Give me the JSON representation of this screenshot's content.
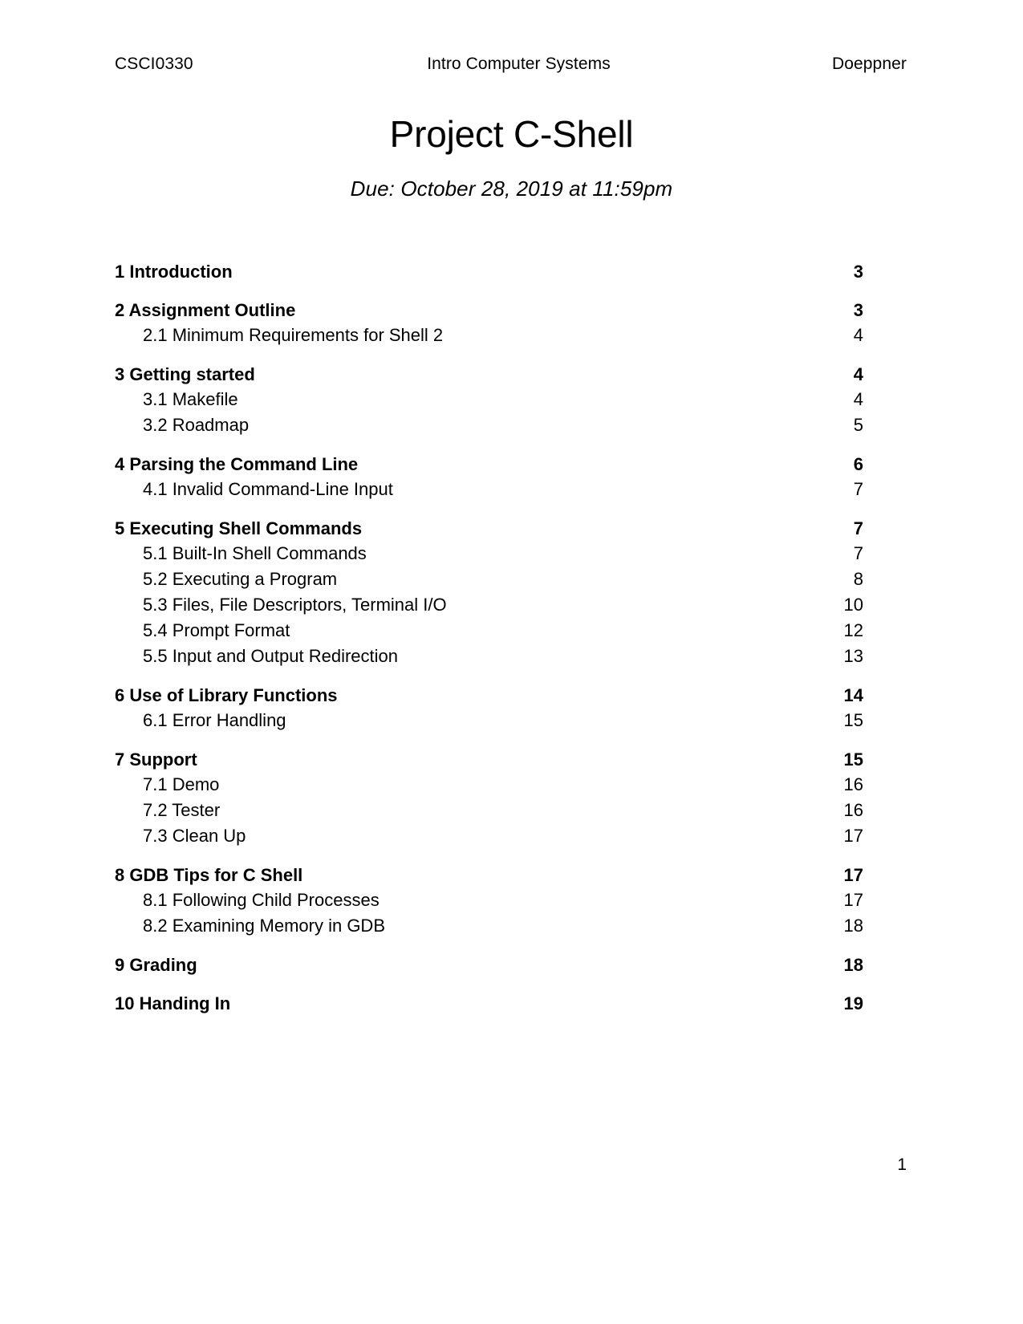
{
  "header": {
    "course_code": "CSCI0330",
    "course_title": "Intro Computer Systems",
    "instructor": "Doeppner"
  },
  "title": "Project C-Shell",
  "subtitle": "Due: October 28, 2019 at 11:59pm",
  "toc": {
    "entries": [
      {
        "level": 1,
        "label": "1 Introduction",
        "page": "3"
      },
      {
        "level": 1,
        "label": "2 Assignment Outline",
        "page": "3"
      },
      {
        "level": 2,
        "label": "2.1 Minimum Requirements for Shell 2",
        "page": "4"
      },
      {
        "level": 1,
        "label": "3 Getting started",
        "page": "4"
      },
      {
        "level": 2,
        "label": "3.1 Makefile",
        "page": "4"
      },
      {
        "level": 2,
        "label": "3.2 Roadmap",
        "page": "5"
      },
      {
        "level": 1,
        "label": "4 Parsing the Command Line",
        "page": "6"
      },
      {
        "level": 2,
        "label": "4.1 Invalid Command-Line Input",
        "page": "7"
      },
      {
        "level": 1,
        "label": "5 Executing Shell Commands",
        "page": "7"
      },
      {
        "level": 2,
        "label": "5.1 Built-In Shell Commands",
        "page": "7"
      },
      {
        "level": 2,
        "label": "5.2 Executing a Program",
        "page": "8"
      },
      {
        "level": 2,
        "label": "5.3 Files, File Descriptors, Terminal I/O",
        "page": "10"
      },
      {
        "level": 2,
        "label": "5.4 Prompt Format",
        "page": "12"
      },
      {
        "level": 2,
        "label": "5.5 Input and Output Redirection",
        "page": "13"
      },
      {
        "level": 1,
        "label": "6 Use of Library Functions",
        "page": "14"
      },
      {
        "level": 2,
        "label": "6.1 Error Handling",
        "page": "15"
      },
      {
        "level": 1,
        "label": "7 Support",
        "page": "15"
      },
      {
        "level": 2,
        "label": "7.1 Demo",
        "page": "16"
      },
      {
        "level": 2,
        "label": "7.2 Tester",
        "page": "16"
      },
      {
        "level": 2,
        "label": "7.3 Clean Up",
        "page": "17"
      },
      {
        "level": 1,
        "label": "8 GDB Tips for C Shell",
        "page": "17"
      },
      {
        "level": 2,
        "label": "8.1 Following Child Processes",
        "page": "17"
      },
      {
        "level": 2,
        "label": "8.2 Examining Memory in GDB",
        "page": "18"
      },
      {
        "level": 1,
        "label": "9 Grading",
        "page": "18"
      },
      {
        "level": 1,
        "label": "10 Handing In",
        "page": "19"
      }
    ]
  },
  "footer": {
    "page_number": "1"
  }
}
